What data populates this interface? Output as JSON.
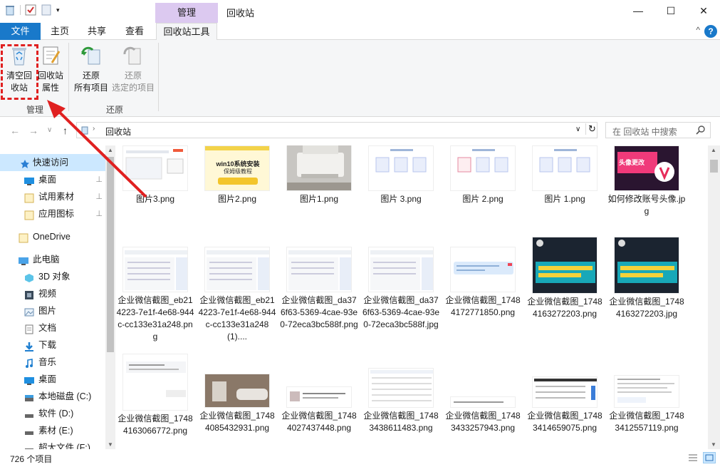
{
  "titlebar": {
    "context_tab": "管理",
    "title": "回收站",
    "minimize": "—",
    "maximize": "☐",
    "close": "✕"
  },
  "tabs": {
    "file": "文件",
    "home": "主页",
    "share": "共享",
    "view": "查看",
    "recycle_tools": "回收站工具",
    "collapse": "^",
    "help": "?"
  },
  "ribbon": {
    "empty_bin_line1": "清空回",
    "empty_bin_line2": "收站",
    "properties_line1": "回收站",
    "properties_line2": "属性",
    "group_manage": "管理",
    "restore_all_line1": "还原",
    "restore_all_line2": "所有项目",
    "restore_selected_line1": "还原",
    "restore_selected_line2": "选定的项目",
    "group_restore": "还原"
  },
  "address": {
    "back": "←",
    "forward": "→",
    "recent": "∨",
    "up": "↑",
    "path": "回收站",
    "dropdown": "∨",
    "refresh": "↻",
    "search_placeholder": "在 回收站 中搜索"
  },
  "nav": {
    "items": [
      {
        "label": "快速访问",
        "icon": "star-icon"
      },
      {
        "label": "桌面",
        "icon": "desktop-icon"
      },
      {
        "label": "试用素材",
        "icon": "folder-icon"
      },
      {
        "label": "应用图标",
        "icon": "folder-icon"
      },
      {
        "label": "OneDrive",
        "icon": "folder-icon"
      },
      {
        "label": "此电脑",
        "icon": "pc-icon"
      },
      {
        "label": "3D 对象",
        "icon": "cube-icon"
      },
      {
        "label": "视频",
        "icon": "video-icon"
      },
      {
        "label": "图片",
        "icon": "picture-icon"
      },
      {
        "label": "文档",
        "icon": "document-icon"
      },
      {
        "label": "下载",
        "icon": "download-icon"
      },
      {
        "label": "音乐",
        "icon": "music-icon"
      },
      {
        "label": "桌面",
        "icon": "desktop-icon"
      },
      {
        "label": "本地磁盘 (C:)",
        "icon": "drive-icon"
      },
      {
        "label": "软件 (D:)",
        "icon": "drive-icon"
      },
      {
        "label": "素材 (E:)",
        "icon": "drive-icon"
      },
      {
        "label": "超大文件 (F:)",
        "icon": "drive-icon"
      }
    ],
    "pin": "📌"
  },
  "files": [
    {
      "name": "图片3.png"
    },
    {
      "name": "图片2.png"
    },
    {
      "name": "图片1.png"
    },
    {
      "name": "图片 3.png"
    },
    {
      "name": "图片 2.png"
    },
    {
      "name": "图片 1.png"
    },
    {
      "name": "如何修改账号头像.jpg"
    },
    {
      "name": "企业微信截图_eb214223-7e1f-4e68-944c-cc133e31a248.png"
    },
    {
      "name": "企业微信截图_eb214223-7e1f-4e68-944c-cc133e31a248(1)...."
    },
    {
      "name": "企业微信截图_da376f63-5369-4cae-93e0-72eca3bc588f.png"
    },
    {
      "name": "企业微信截图_da376f63-5369-4cae-93e0-72eca3bc588f.jpg"
    },
    {
      "name": "企业微信截图_17484172771850.png"
    },
    {
      "name": "企业微信截图_17484163272203.png"
    },
    {
      "name": "企业微信截图_17484163272203.jpg"
    },
    {
      "name": "企业微信截图_17484163066772.png"
    },
    {
      "name": "企业微信截图_17484085432931.png"
    },
    {
      "name": "企业微信截图_17484027437448.png"
    },
    {
      "name": "企业微信截图_17483438611483.png"
    },
    {
      "name": "企业微信截图_17483433257943.png"
    },
    {
      "name": "企业微信截图_17483414659075.png"
    },
    {
      "name": "企业微信截图_17483412557119.png"
    }
  ],
  "thumb_text": {
    "img2_banner": "win10系统安装",
    "img2_sub": "保姆级教程",
    "avatar_title": "头像更改"
  },
  "status": {
    "count": "726 个项目"
  },
  "colors": {
    "accent": "#1979ca",
    "context_tab": "#dcc9f0",
    "highlight": "#e02020"
  }
}
